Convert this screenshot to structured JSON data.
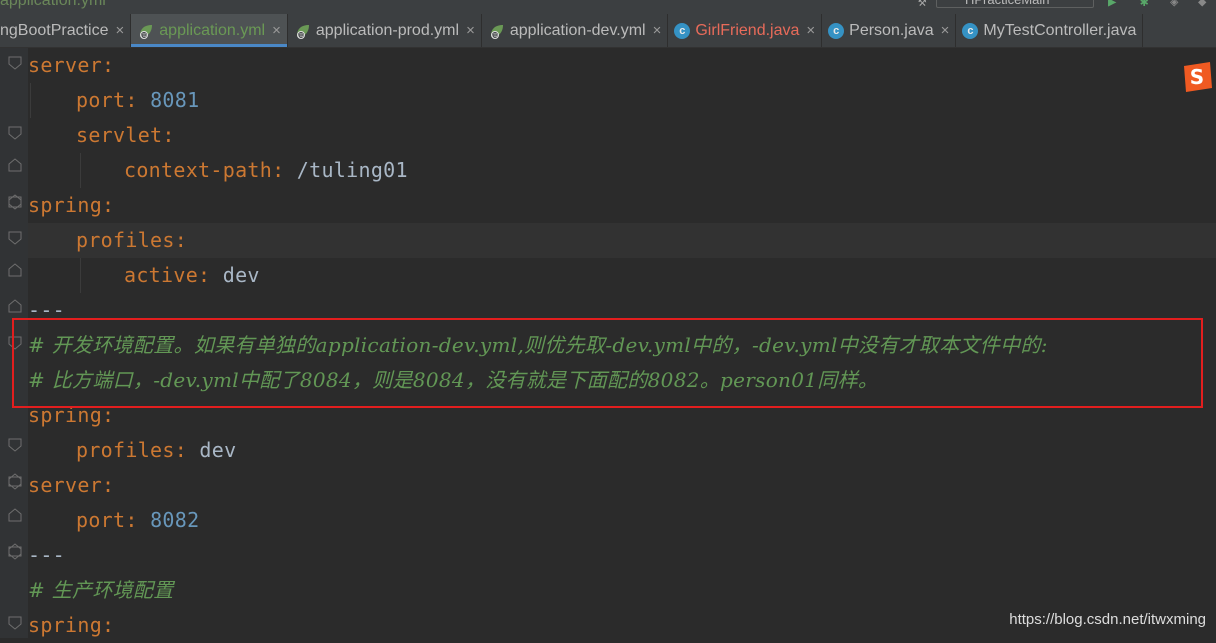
{
  "topbar": {
    "breadcrumb": "application.yml",
    "run_config": "HPracticeMain"
  },
  "tabs": [
    {
      "label": "ngBootPractice",
      "icon": "none",
      "color": "#bbbbbb",
      "active": false
    },
    {
      "label": "application.yml",
      "icon": "spring-leaf-icon",
      "color": "#6a9955",
      "active": true
    },
    {
      "label": "application-prod.yml",
      "icon": "spring-leaf-icon",
      "color": "#bbbbbb",
      "active": false
    },
    {
      "label": "application-dev.yml",
      "icon": "spring-leaf-icon",
      "color": "#bbbbbb",
      "active": false
    },
    {
      "label": "GirlFriend.java",
      "icon": "class-icon",
      "color": "#e86b5a",
      "active": false
    },
    {
      "label": "Person.java",
      "icon": "class-icon",
      "color": "#bbbbbb",
      "active": false
    },
    {
      "label": "MyTestController.java",
      "icon": "class-icon",
      "color": "#bbbbbb",
      "active": false
    }
  ],
  "close_glyph": "×",
  "code": {
    "l1_key": "server",
    "colon": ":",
    "l2_key": "port",
    "l2_val": "8081",
    "l3_key": "servlet",
    "l4_key": "context-path",
    "l4_val": "/tuling01",
    "l5_key": "spring",
    "l6_key": "profiles",
    "l7_key": "active",
    "l7_val": "dev",
    "l8_sep": "---",
    "l9_comment": "# 开发环境配置。如果有单独的application-dev.yml,则优先取-dev.yml中的，-dev.yml中没有才取本文件中的:",
    "l10_comment": "# 比方端口，-dev.yml中配了8084，则是8084，没有就是下面配的8082。person01同样。",
    "l11_key": "spring",
    "l12_key": "profiles",
    "l12_val": "dev",
    "l13_key": "server",
    "l14_key": "port",
    "l14_val": "8082",
    "l15_sep": "---",
    "l16_comment": "# 生产环境配置",
    "l17_key": "spring"
  },
  "watermark": "https://blog.csdn.net/itwxming",
  "colors": {
    "key": "#cc7832",
    "number": "#6897bb",
    "comment": "#629755",
    "highlight_box": "#e21e1e",
    "background": "#2b2b2b"
  }
}
